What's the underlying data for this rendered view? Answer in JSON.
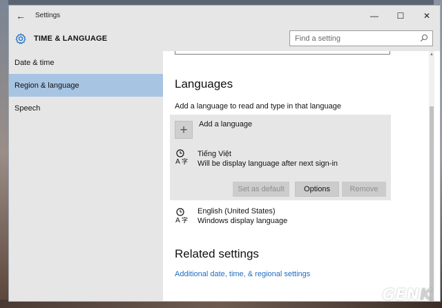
{
  "window": {
    "title": "Settings",
    "controls": {
      "minimize": "—",
      "maximize": "☐",
      "close": "✕"
    }
  },
  "header": {
    "title": "TIME & LANGUAGE",
    "search_placeholder": "Find a setting",
    "search_value": ""
  },
  "sidebar": {
    "items": [
      {
        "label": "Date & time",
        "active": false
      },
      {
        "label": "Region & language",
        "active": true
      },
      {
        "label": "Speech",
        "active": false
      }
    ]
  },
  "main": {
    "languages_heading": "Languages",
    "languages_subtext": "Add a language to read and type in that language",
    "add_language_label": "Add a language",
    "languages": [
      {
        "name": "Tiếng Việt",
        "description": "Will be display language after next sign-in",
        "selected": true
      },
      {
        "name": "English (United States)",
        "description": "Windows display language",
        "selected": false
      }
    ],
    "buttons": {
      "set_as_default": "Set as default",
      "options": "Options",
      "remove": "Remove"
    },
    "related_heading": "Related settings",
    "related_link": "Additional date, time, & regional settings"
  },
  "watermark": {
    "prefix": "GEN",
    "suffix": "K"
  },
  "colors": {
    "accent": "#1f6cc0",
    "sidebar_active": "#a8c4e3",
    "panel_gray": "#e6e6e6"
  },
  "icons": {
    "back": "arrow-left-icon",
    "settings": "gear-icon",
    "search": "search-icon",
    "add": "plus-icon",
    "language": "language-icon"
  }
}
